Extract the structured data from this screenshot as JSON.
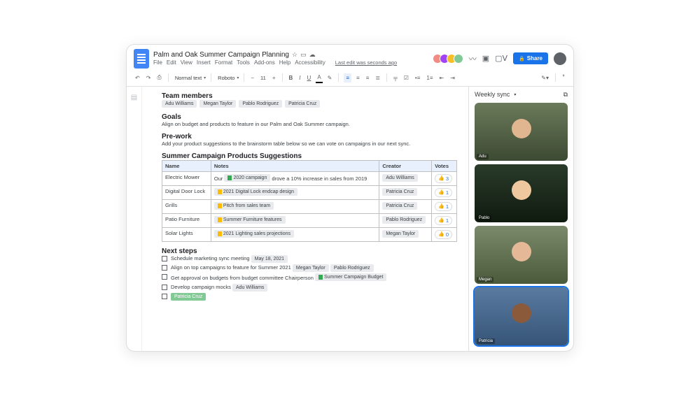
{
  "header": {
    "title": "Palm and Oak Summer Campaign Planning",
    "last_edit": "Last edit was seconds ago",
    "menus": [
      "File",
      "Edit",
      "View",
      "Insert",
      "Format",
      "Tools",
      "Add-ons",
      "Help",
      "Accessibility"
    ],
    "share_label": "Share"
  },
  "toolbar": {
    "style_select": "Normal text",
    "font_select": "Roboto",
    "size_select": "11"
  },
  "doc": {
    "sections": {
      "team": {
        "heading": "Team members",
        "members": [
          "Adu Williams",
          "Megan Taylor",
          "Pablo Rodriguez",
          "Patricia Cruz"
        ]
      },
      "goals": {
        "heading": "Goals",
        "body": "Align on budget and products to feature in our Palm and Oak Summer campaign."
      },
      "prework": {
        "heading": "Pre-work",
        "body": "Add your product suggestions to the brainstorm table below so we can vote on campaigns in our next sync."
      },
      "table": {
        "heading": "Summer Campaign Products Suggestions",
        "cols": [
          "Name",
          "Notes",
          "Creator",
          "Votes"
        ],
        "rows": [
          {
            "name": "Electric Mower",
            "note_pre": "Our ",
            "note_chip": "2020 campaign",
            "note_chip_type": "sheet",
            "note_post": " drove a 10% increase in sales from 2019",
            "creator": "Adu Williams",
            "votes": "3"
          },
          {
            "name": "Digital Door Lock",
            "note_pre": "",
            "note_chip": "2021 Digital Lock endcap design",
            "note_chip_type": "doc",
            "note_post": "",
            "creator": "Patricia Cruz",
            "votes": "1"
          },
          {
            "name": "Grills",
            "note_pre": "",
            "note_chip": "Pitch from sales team",
            "note_chip_type": "doc",
            "note_post": "",
            "creator": "Patricia Cruz",
            "votes": "1"
          },
          {
            "name": "Patio Furniture",
            "note_pre": "",
            "note_chip": "Summer Furniture features",
            "note_chip_type": "doc",
            "note_post": "",
            "creator": "Pablo Rodriguez",
            "votes": "1"
          },
          {
            "name": "Solar Lights",
            "note_pre": "",
            "note_chip": "2021 Lighting sales projections",
            "note_chip_type": "doc",
            "note_post": "",
            "creator": "Megan Taylor",
            "votes": "0"
          }
        ]
      },
      "next": {
        "heading": "Next steps",
        "items": [
          {
            "text": "Schedule marketing sync meeting",
            "chips": [
              {
                "label": "May 18, 2021",
                "type": "plain"
              }
            ]
          },
          {
            "text": "Align on top campaigns to feature for Summer 2021",
            "chips": [
              {
                "label": "Megan Taylor",
                "type": "plain"
              },
              {
                "label": "Pablo Rodriguez",
                "type": "plain"
              }
            ]
          },
          {
            "text": "Get approval on budgets from budget committee Chairperson",
            "chips": [
              {
                "label": "Summer Campaign Budget",
                "type": "sheet"
              }
            ]
          },
          {
            "text": "Develop campaign mocks",
            "chips": [
              {
                "label": "Adu Williams",
                "type": "plain"
              }
            ]
          },
          {
            "text": "",
            "chips": [
              {
                "label": "Patricia Cruz",
                "type": "green"
              }
            ]
          }
        ]
      }
    }
  },
  "video": {
    "title": "Weekly sync",
    "participants": [
      {
        "name": "Adu"
      },
      {
        "name": "Pablo"
      },
      {
        "name": "Megan"
      },
      {
        "name": "Patricia"
      }
    ]
  }
}
